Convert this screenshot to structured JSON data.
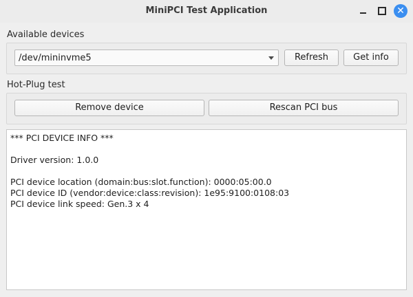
{
  "window": {
    "title": "MiniPCI Test Application",
    "controls": {
      "minimize_icon": "minimize-icon",
      "maximize_icon": "maximize-icon",
      "close_icon": "close-icon",
      "close_color": "#3a8ef0"
    }
  },
  "devices": {
    "label": "Available devices",
    "selected": "/dev/mininvme5",
    "refresh_label": "Refresh",
    "info_label": "Get info"
  },
  "hotplug": {
    "label": "Hot-Plug test",
    "remove_label": "Remove device",
    "rescan_label": "Rescan PCI bus"
  },
  "output": {
    "lines": [
      "*** PCI DEVICE INFO ***",
      "",
      "Driver version: 1.0.0",
      "",
      "PCI device location (domain:bus:slot.function): 0000:05:00.0",
      "PCI device ID (vendor:device:class:revision): 1e95:9100:0108:03",
      "PCI device link speed: Gen.3 x 4"
    ]
  }
}
